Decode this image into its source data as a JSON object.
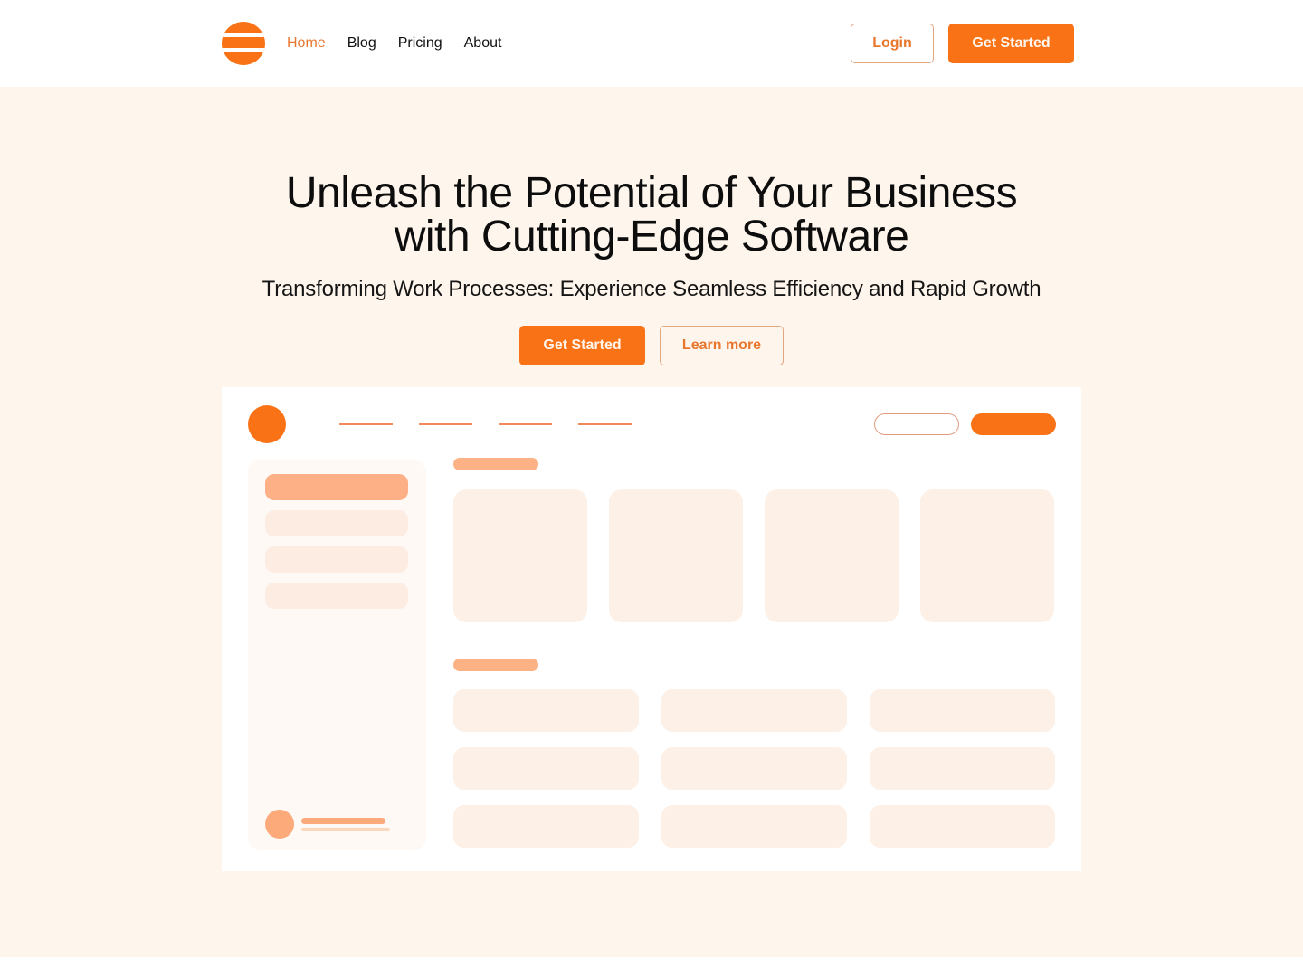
{
  "header": {
    "logo": "striped-circle-logo",
    "nav": [
      {
        "label": "Home",
        "active": true
      },
      {
        "label": "Blog",
        "active": false
      },
      {
        "label": "Pricing",
        "active": false
      },
      {
        "label": "About",
        "active": false
      }
    ],
    "login_label": "Login",
    "get_started_label": "Get Started"
  },
  "hero": {
    "title_line1": "Unleash the Potential of Your Business",
    "title_line2": "with Cutting-Edge Software",
    "subtitle": "Transforming Work Processes: Experience Seamless Efficiency and Rapid Growth",
    "primary_cta": "Get Started",
    "secondary_cta": "Learn more"
  },
  "mockup": {
    "nav_placeholder_count": 4,
    "sidebar_item_count": 4,
    "active_sidebar_item": 0,
    "card_count": 4,
    "list_rows": 3,
    "list_cols": 3
  },
  "colors": {
    "brand": "#f97316",
    "brand_text": "#e8772e",
    "hero_bg": "#fef5ec",
    "placeholder_light": "#fdf0e6",
    "placeholder_mid": "#fdb086"
  }
}
